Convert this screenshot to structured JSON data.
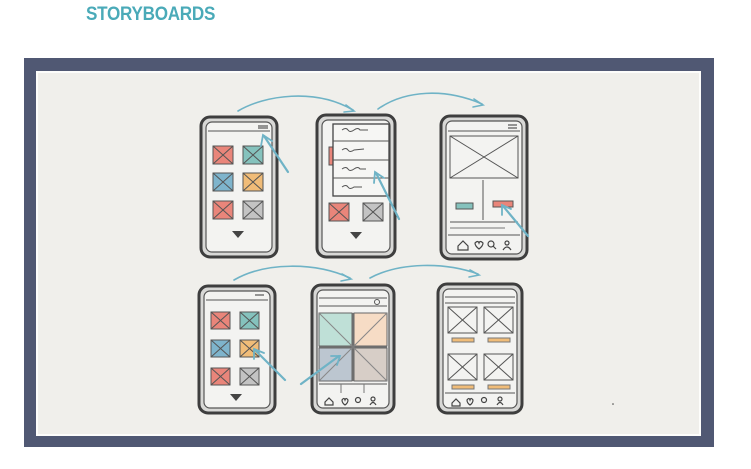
{
  "page": {
    "title": "STORYBOARDS",
    "title_color": "#4aaab8",
    "frame_color": "#505873",
    "paper_color": "#f0efeb"
  },
  "storyboard": {
    "colors": {
      "salmon": "#e9857a",
      "teal": "#85c2bd",
      "blue": "#7eb4cc",
      "orange": "#f0bc78",
      "gray": "#c3c3c3",
      "arrow": "#6fb3c6",
      "ink": "#4b4b4b"
    },
    "screens": [
      {
        "id": "home-grid",
        "content": "icon-grid"
      },
      {
        "id": "menu-open",
        "content": "dropdown-menu"
      },
      {
        "id": "detail",
        "content": "image-detail"
      },
      {
        "id": "home-grid-2",
        "content": "icon-grid"
      },
      {
        "id": "gallery-tiles",
        "content": "color-tiles"
      },
      {
        "id": "gallery-list",
        "content": "image-list"
      }
    ]
  }
}
